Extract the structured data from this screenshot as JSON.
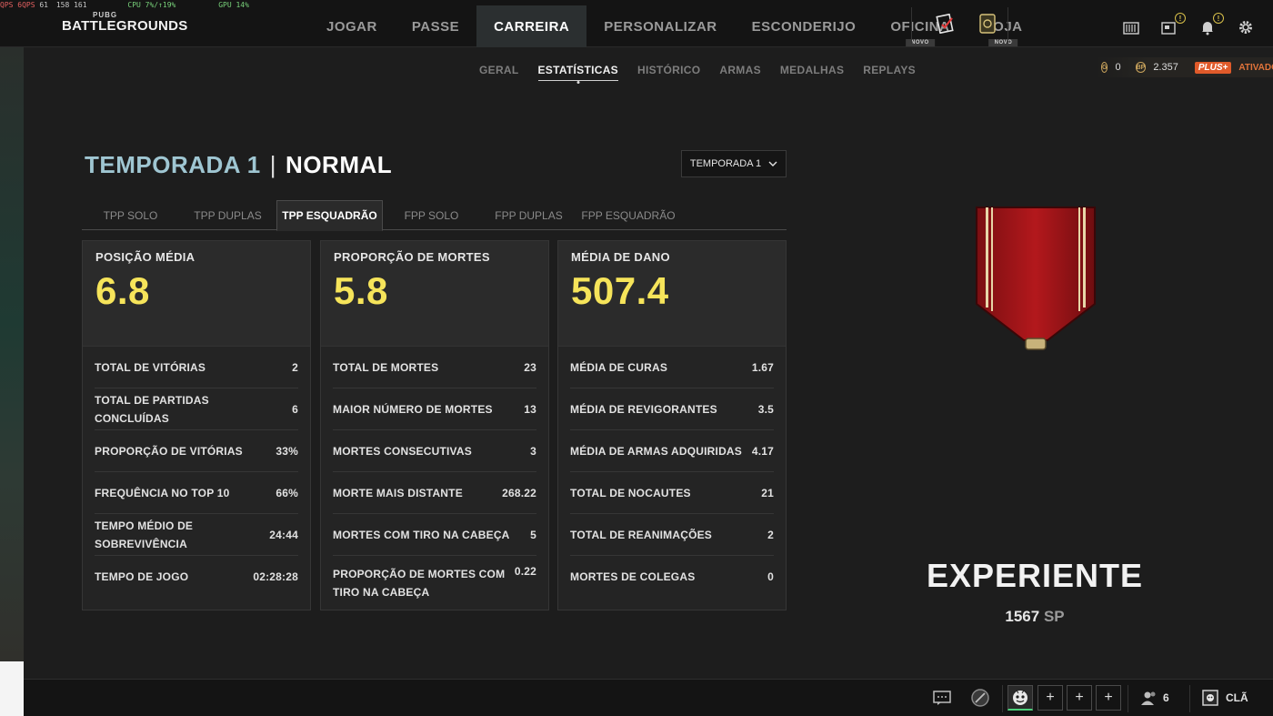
{
  "overlay": {
    "fps": "QPS 6QPS",
    "fps_value": "61",
    "frame": "158 161",
    "cpu": "CPU 7%/↑19%",
    "gpu": "GPU 14%"
  },
  "brand": {
    "small": "PUBG",
    "big": "BATTLEGROUNDS"
  },
  "nav": {
    "items": [
      {
        "label": "JOGAR",
        "badge": ""
      },
      {
        "label": "PASSE",
        "badge": ""
      },
      {
        "label": "CARREIRA",
        "badge": ""
      },
      {
        "label": "PERSONALIZAR",
        "badge": ""
      },
      {
        "label": "ESCONDERIJO",
        "badge": ""
      },
      {
        "label": "OFICINA",
        "badge": "NOVO"
      },
      {
        "label": "LOJA",
        "badge": "NOVO"
      }
    ],
    "active": "CARREIRA"
  },
  "topicons": {
    "missions": "checklist-icon",
    "card": "card-icon",
    "storage": "storage-icon",
    "news": "news-icon",
    "notifications": "bell-icon",
    "settings": "gear-icon",
    "alert_mark": "!"
  },
  "subnav": {
    "items": [
      "GERAL",
      "ESTATÍSTICAS",
      "HISTÓRICO",
      "ARMAS",
      "MEDALHAS",
      "REPLAYS"
    ],
    "active": "ESTATÍSTICAS"
  },
  "currency": {
    "g_symbol": "G",
    "g_coin": "0",
    "bp_symbol": "BP",
    "bp": "2.357",
    "plus_label": "PLUS+",
    "plus_status": "ATIVADO"
  },
  "header": {
    "season": "TEMPORADA 1",
    "separator": "|",
    "mode": "NORMAL",
    "select_value": "TEMPORADA 1"
  },
  "tabs": [
    "TPP SOLO",
    "TPP DUPLAS",
    "TPP ESQUADRÃO",
    "FPP SOLO",
    "FPP DUPLAS",
    "FPP ESQUADRÃO"
  ],
  "active_tab": "TPP ESQUADRÃO",
  "cards": [
    {
      "label": "POSIÇÃO MÉDIA",
      "value": "6.8",
      "rows": [
        {
          "k": "TOTAL DE VITÓRIAS",
          "v": "2"
        },
        {
          "k": "TOTAL DE PARTIDAS CONCLUÍDAS",
          "v": "6"
        },
        {
          "k": "PROPORÇÃO DE VITÓRIAS",
          "v": "33%"
        },
        {
          "k": "FREQUÊNCIA NO TOP 10",
          "v": "66%"
        },
        {
          "k": "TEMPO MÉDIO DE SOBREVIVÊNCIA",
          "v": "24:44"
        },
        {
          "k": "TEMPO DE JOGO",
          "v": "02:28:28"
        }
      ]
    },
    {
      "label": "PROPORÇÃO DE MORTES",
      "value": "5.8",
      "rows": [
        {
          "k": "TOTAL DE MORTES",
          "v": "23"
        },
        {
          "k": "MAIOR NÚMERO DE MORTES",
          "v": "13"
        },
        {
          "k": "MORTES CONSECUTIVAS",
          "v": "3"
        },
        {
          "k": "MORTE MAIS DISTANTE",
          "v": "268.22"
        },
        {
          "k": "MORTES COM TIRO NA CABEÇA",
          "v": "5"
        },
        {
          "k": "PROPORÇÃO DE MORTES COM TIRO NA CABEÇA",
          "v": "0.22"
        }
      ]
    },
    {
      "label": "MÉDIA DE DANO",
      "value": "507.4",
      "rows": [
        {
          "k": "MÉDIA DE CURAS",
          "v": "1.67"
        },
        {
          "k": "MÉDIA DE REVIGORANTES",
          "v": "3.5"
        },
        {
          "k": "MÉDIA DE ARMAS ADQUIRIDAS",
          "v": "4.17"
        },
        {
          "k": "TOTAL DE NOCAUTES",
          "v": "21"
        },
        {
          "k": "TOTAL DE REANIMAÇÕES",
          "v": "2"
        },
        {
          "k": "MORTES DE COLEGAS",
          "v": "0"
        }
      ]
    }
  ],
  "rank": {
    "name": "EXPERIENTE",
    "points": "1567",
    "unit": "SP",
    "medal": "medal-ribbon-red"
  },
  "bottom": {
    "chat": "chat-icon",
    "compass": "compass-icon",
    "friends_count": "6",
    "clan_label": "CLÃ",
    "slot_plus": "+"
  },
  "colors": {
    "accent_value": "#f6e45a",
    "season": "#9fc6d2",
    "plus": "#e05a2a",
    "ready": "#4cd07a"
  }
}
